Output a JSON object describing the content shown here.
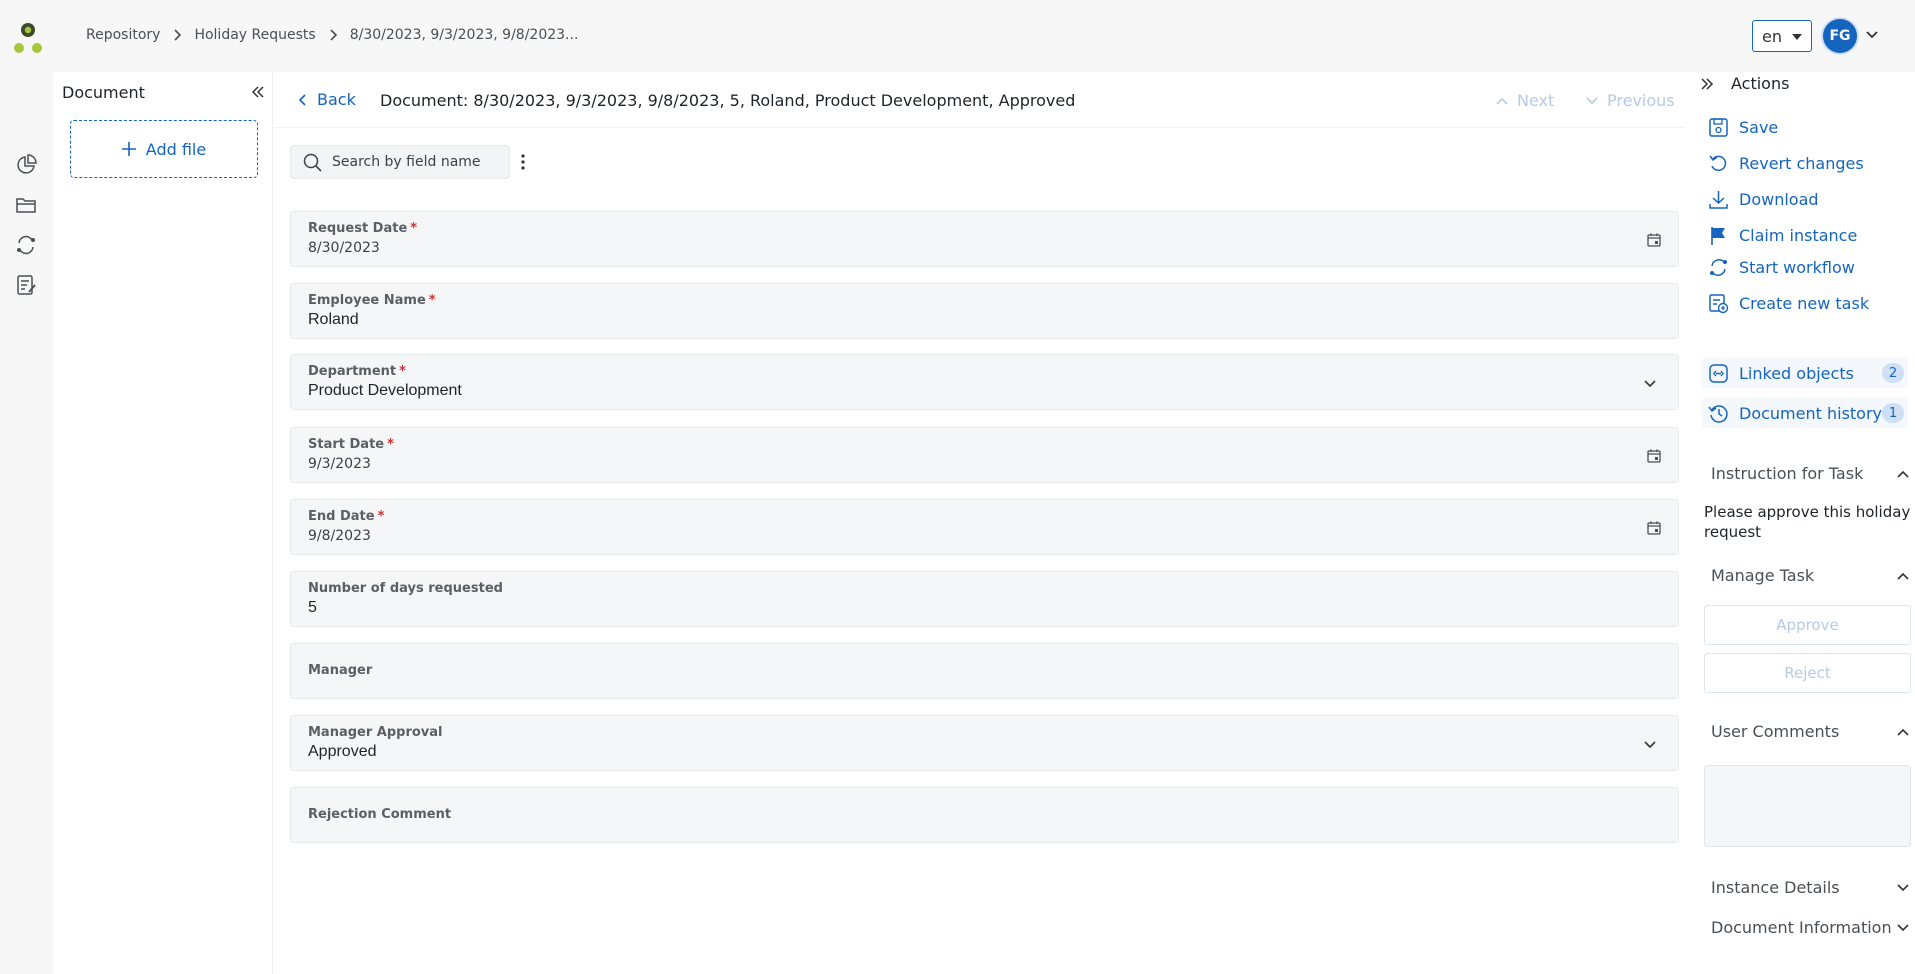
{
  "breadcrumb": [
    "Repository",
    "Holiday Requests",
    "8/30/2023, 9/3/2023, 9/8/2023..."
  ],
  "language": "en",
  "user_initials": "FG",
  "doc_panel": {
    "title": "Document",
    "add_file_label": "Add file"
  },
  "header": {
    "back_label": "Back",
    "title": "Document: 8/30/2023, 9/3/2023, 9/8/2023, 5, Roland, Product Development, Approved",
    "next_label": "Next",
    "previous_label": "Previous"
  },
  "search": {
    "placeholder": "Search by field name"
  },
  "fields": [
    {
      "label": "Request Date",
      "required": "*",
      "value": "8/30/2023",
      "kind": "date"
    },
    {
      "label": "Employee Name",
      "required": "*",
      "value": "Roland",
      "kind": "text"
    },
    {
      "label": "Department",
      "required": "*",
      "value": "Product Development",
      "kind": "select"
    },
    {
      "label": "Start Date",
      "required": "*",
      "value": "9/3/2023",
      "kind": "date"
    },
    {
      "label": "End Date",
      "required": "*",
      "value": "9/8/2023",
      "kind": "date"
    },
    {
      "label": "Number of days requested",
      "required": "",
      "value": "5",
      "kind": "text"
    },
    {
      "label": "Manager",
      "required": "",
      "value": "",
      "kind": "empty"
    },
    {
      "label": "Manager Approval",
      "required": "",
      "value": "Approved",
      "kind": "select"
    },
    {
      "label": "Rejection Comment",
      "required": "",
      "value": "",
      "kind": "empty"
    }
  ],
  "actions_panel": {
    "title": "Actions",
    "actions": [
      {
        "label": "Save",
        "icon": "save-icon"
      },
      {
        "label": "Revert changes",
        "icon": "revert-icon"
      },
      {
        "label": "Download",
        "icon": "download-icon"
      },
      {
        "label": "Claim instance",
        "icon": "flag-icon"
      },
      {
        "label": "Start workflow",
        "icon": "workflow-icon"
      },
      {
        "label": "Create new task",
        "icon": "task-icon"
      }
    ],
    "linked_objects": {
      "label": "Linked objects",
      "count": "2"
    },
    "document_history": {
      "label": "Document history",
      "count": "1"
    },
    "instruction_title": "Instruction for Task",
    "instruction_text": "Please approve this holiday request",
    "manage_task_title": "Manage Task",
    "approve_label": "Approve",
    "reject_label": "Reject",
    "user_comments_title": "User Comments",
    "instance_details_title": "Instance Details",
    "document_information_title": "Document Information"
  },
  "colors": {
    "accent": "#1565c0",
    "logo_dark": "#3d4a2c",
    "logo_green": "#a7c83a",
    "required": "#d32f2f"
  }
}
